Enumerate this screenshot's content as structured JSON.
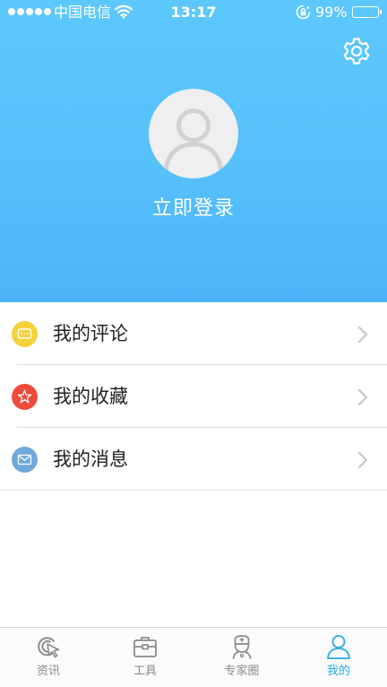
{
  "status_bar": {
    "carrier": "中国电信",
    "time": "13:17",
    "battery": "99%",
    "battery_level": 0.99,
    "signal_bars": 5
  },
  "header": {
    "settings_icon": "gear-icon",
    "avatar_icon": "default-user-avatar-icon",
    "login_label": "立即登录"
  },
  "menu": {
    "items": [
      {
        "label": "我的评论",
        "icon": "comment-icon",
        "color": "#f6d23a"
      },
      {
        "label": "我的收藏",
        "icon": "star-icon",
        "color": "#ee4b3a"
      },
      {
        "label": "我的消息",
        "icon": "mail-icon",
        "color": "#6fa9dc"
      }
    ]
  },
  "tabbar": {
    "items": [
      {
        "label": "资讯",
        "icon": "news-icon"
      },
      {
        "label": "工具",
        "icon": "toolbox-icon"
      },
      {
        "label": "专家圈",
        "icon": "doctor-icon"
      },
      {
        "label": "我的",
        "icon": "user-icon",
        "active": true
      }
    ]
  },
  "colors": {
    "hero_top": "#5cc8fc",
    "hero_bottom": "#4bb4f8",
    "accent": "#2aa9e6",
    "inactive": "#8a8a8a"
  }
}
